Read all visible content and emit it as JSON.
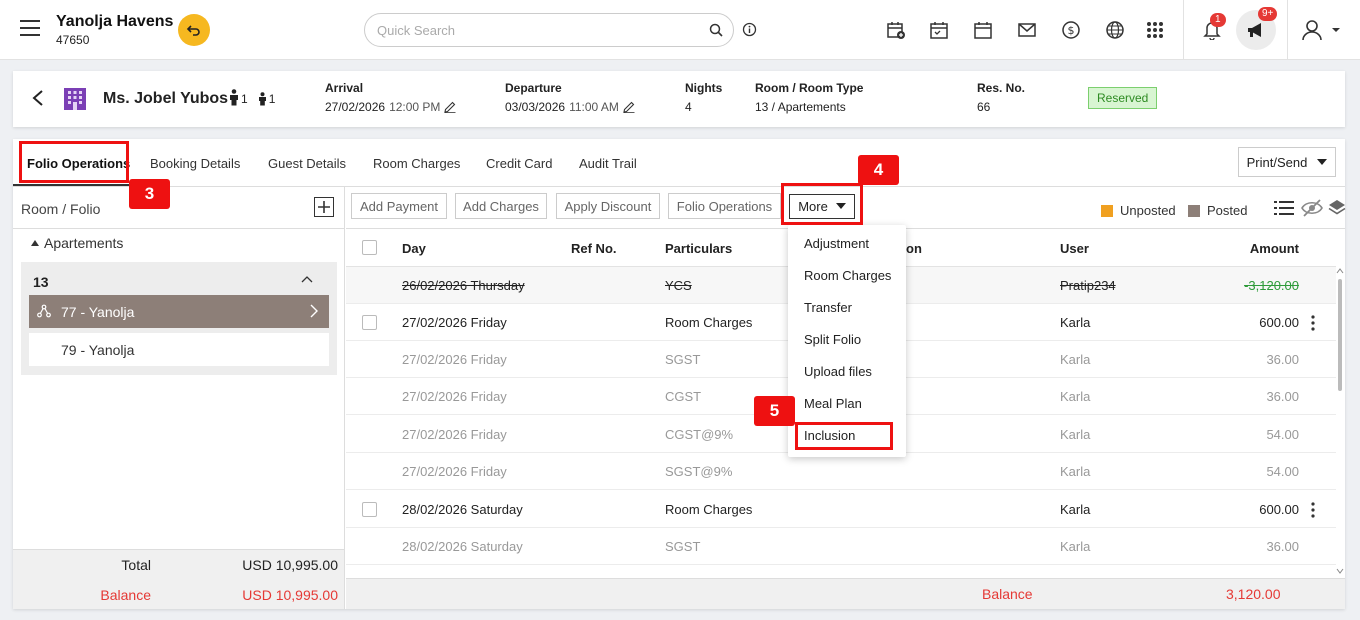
{
  "header": {
    "hotel_name": "Yanolja Havens",
    "hotel_id": "47650",
    "search_placeholder": "Quick Search",
    "bell_count": "1",
    "announce_count": "9+"
  },
  "reservation": {
    "guest_name": "Ms. Jobel Yubos",
    "adults": "1",
    "children": "1",
    "arrival_label": "Arrival",
    "arrival_date": "27/02/2026",
    "arrival_time": "12:00 PM",
    "departure_label": "Departure",
    "departure_date": "03/03/2026",
    "departure_time": "11:00 AM",
    "nights_label": "Nights",
    "nights": "4",
    "room_label": "Room / Room Type",
    "room": "13 / Apartements",
    "res_no_label": "Res. No.",
    "res_no": "66",
    "status": "Reserved"
  },
  "tabs": [
    "Folio Operations",
    "Booking Details",
    "Guest Details",
    "Room Charges",
    "Credit Card",
    "Audit Trail"
  ],
  "print_send": "Print/Send",
  "left": {
    "header": "Room / Folio",
    "group": "Apartements",
    "room_no": "13",
    "folios": [
      "77 - Yanolja",
      "79 - Yanolja"
    ],
    "total_label": "Total",
    "total_value": "USD 10,995.00",
    "balance_label": "Balance",
    "balance_value": "USD 10,995.00"
  },
  "toolbar": {
    "add_payment": "Add Payment",
    "add_charges": "Add Charges",
    "apply_discount": "Apply Discount",
    "folio_operations": "Folio Operations",
    "more": "More",
    "unposted": "Unposted",
    "posted": "Posted"
  },
  "colors": {
    "unposted": "#f0a020",
    "posted": "#8d7f78",
    "accent": "#e11111"
  },
  "table": {
    "headers": {
      "day": "Day",
      "ref": "Ref No.",
      "particulars": "Particulars",
      "description_suffix": "on",
      "user": "User",
      "amount": "Amount"
    },
    "rows": [
      {
        "day": "26/02/2026 Thursday",
        "particulars": "YCS",
        "user": "Pratip234",
        "amount": "-3,120.00",
        "kind": "void"
      },
      {
        "day": "27/02/2026 Friday",
        "particulars": "Room Charges",
        "user": "Karla",
        "amount": "600.00",
        "kind": "main"
      },
      {
        "day": "27/02/2026 Friday",
        "particulars": "SGST",
        "user": "Karla",
        "amount": "36.00",
        "kind": "sub"
      },
      {
        "day": "27/02/2026 Friday",
        "particulars": "CGST",
        "user": "Karla",
        "amount": "36.00",
        "kind": "sub"
      },
      {
        "day": "27/02/2026 Friday",
        "particulars": "CGST@9%",
        "user": "Karla",
        "amount": "54.00",
        "kind": "sub"
      },
      {
        "day": "27/02/2026 Friday",
        "particulars": "SGST@9%",
        "user": "Karla",
        "amount": "54.00",
        "kind": "sub"
      },
      {
        "day": "28/02/2026 Saturday",
        "particulars": "Room Charges",
        "user": "Karla",
        "amount": "600.00",
        "kind": "main"
      },
      {
        "day": "28/02/2026 Saturday",
        "particulars": "SGST",
        "user": "Karla",
        "amount": "36.00",
        "kind": "sub"
      }
    ],
    "balance_label": "Balance",
    "balance_value": "3,120.00"
  },
  "more_menu": [
    "Adjustment",
    "Room Charges",
    "Transfer",
    "Split Folio",
    "Upload files",
    "Meal Plan",
    "Inclusion"
  ],
  "annotations": {
    "step3": "3",
    "step4": "4",
    "step5": "5"
  }
}
